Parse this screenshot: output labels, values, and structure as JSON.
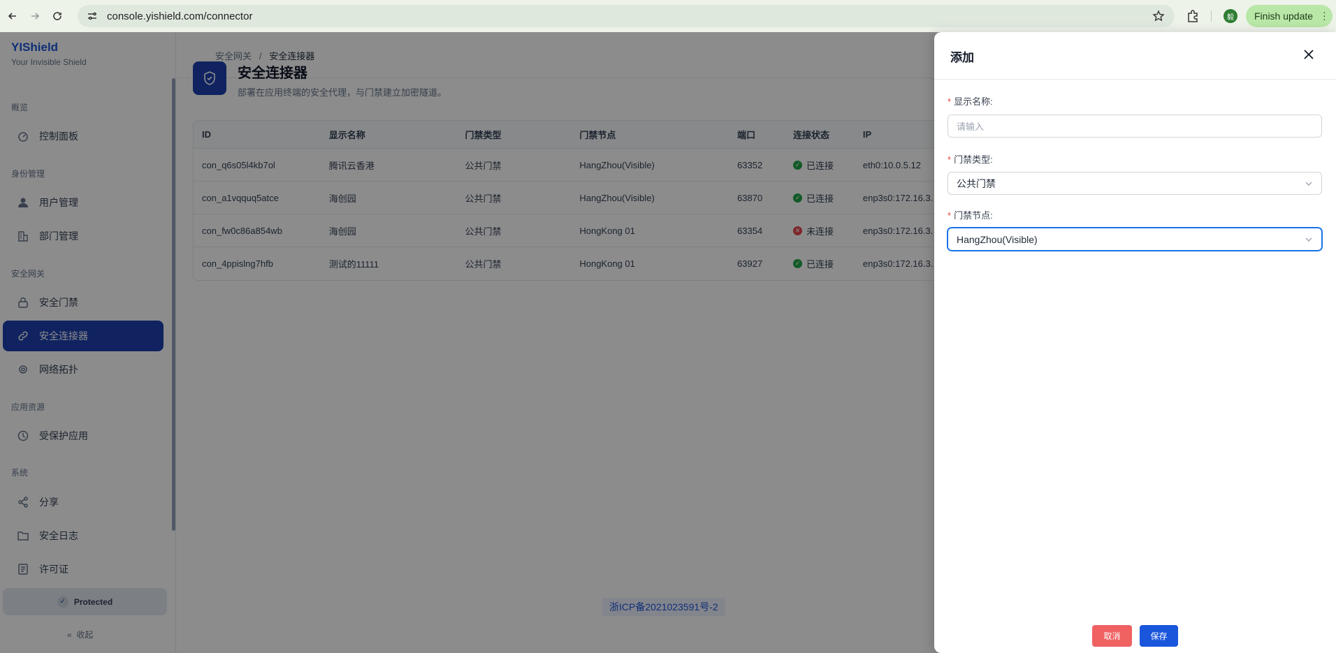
{
  "browser": {
    "url": "console.yishield.com/connector",
    "profile_initial": "毅",
    "finish_update_label": "Finish update"
  },
  "brand": {
    "name": "YIShield",
    "tagline": "Your Invisible Shield"
  },
  "sidebar": {
    "sections": [
      {
        "label": "概览"
      },
      {
        "label": "身份管理"
      },
      {
        "label": "安全网关"
      },
      {
        "label": "应用资源"
      },
      {
        "label": "系统"
      }
    ],
    "items": [
      {
        "label": "控制面板",
        "icon": "dashboard-icon"
      },
      {
        "label": "用户管理",
        "icon": "user-icon"
      },
      {
        "label": "部门管理",
        "icon": "building-icon"
      },
      {
        "label": "安全门禁",
        "icon": "lock-icon"
      },
      {
        "label": "安全连接器",
        "icon": "link-icon",
        "active": true
      },
      {
        "label": "网络拓扑",
        "icon": "network-icon"
      },
      {
        "label": "受保护应用",
        "icon": "protected-app-icon"
      },
      {
        "label": "分享",
        "icon": "share-icon"
      },
      {
        "label": "安全日志",
        "icon": "folder-icon"
      },
      {
        "label": "许可证",
        "icon": "license-icon"
      }
    ],
    "protected_label": "Protected",
    "collapse_label": "收起"
  },
  "breadcrumb": {
    "parent": "安全网关",
    "separator": "/",
    "current": "安全连接器"
  },
  "page": {
    "title": "安全连接器",
    "subtitle": "部署在应用终端的安全代理，与门禁建立加密隧道。"
  },
  "table": {
    "headers": [
      "ID",
      "显示名称",
      "门禁类型",
      "门禁节点",
      "端口",
      "连接状态",
      "IP"
    ],
    "rows": [
      {
        "id": "con_q6s05l4kb7ol",
        "name": "腾讯云香港",
        "type": "公共门禁",
        "node": "HangZhou(Visible)",
        "port": "63352",
        "status": "已连接",
        "ok": true,
        "ip": "eth0:10.0.5.12"
      },
      {
        "id": "con_a1vqquq5atce",
        "name": "海创园",
        "type": "公共门禁",
        "node": "HangZhou(Visible)",
        "port": "63870",
        "status": "已连接",
        "ok": true,
        "ip": "enp3s0:172.16.3."
      },
      {
        "id": "con_fw0c86a854wb",
        "name": "海创园",
        "type": "公共门禁",
        "node": "HongKong 01",
        "port": "63354",
        "status": "未连接",
        "ok": false,
        "ip": "enp3s0:172.16.3."
      },
      {
        "id": "con_4ppislng7hfb",
        "name": "测试的11111",
        "type": "公共门禁",
        "node": "HongKong 01",
        "port": "63927",
        "status": "已连接",
        "ok": true,
        "ip": "enp3s0:172.16.3."
      }
    ]
  },
  "footer": {
    "icp": "浙ICP备2021023591号-2"
  },
  "drawer": {
    "title": "添加",
    "fields": {
      "display_name": {
        "label": "显示名称:",
        "placeholder": "请输入",
        "value": ""
      },
      "gate_type": {
        "label": "门禁类型:",
        "value": "公共门禁"
      },
      "gate_node": {
        "label": "门禁节点:",
        "value": "HangZhou(Visible)"
      }
    },
    "cancel_label": "取消",
    "save_label": "保存"
  },
  "colors": {
    "primary": "#1e40af",
    "accent": "#1a56db",
    "danger": "#f06161",
    "success": "#22a447",
    "error": "#e5484d"
  }
}
